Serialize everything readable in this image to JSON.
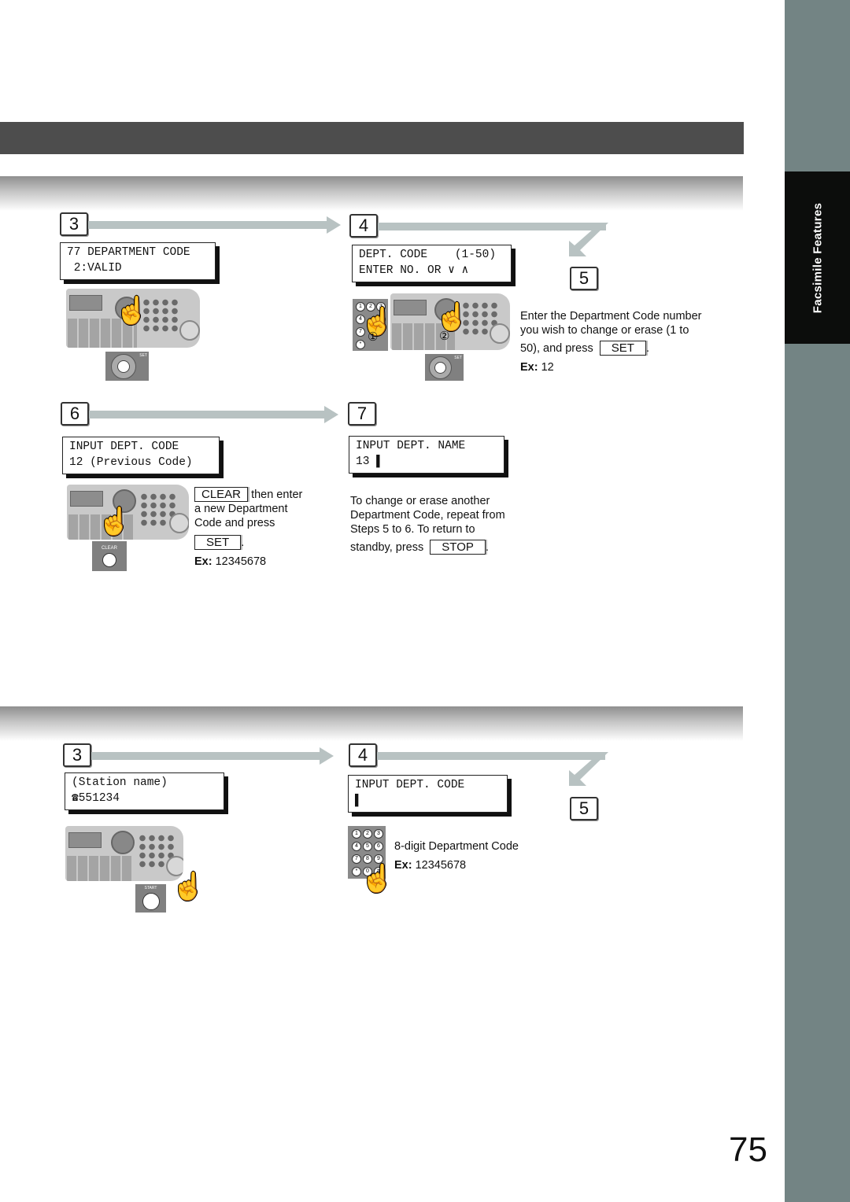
{
  "sidebar": {
    "tab_label": "Facsimile Features"
  },
  "page_number": "75",
  "section1": {
    "steps": [
      {
        "num": "3",
        "lcd": [
          "77 DEPARTMENT CODE",
          " 2:VALID"
        ],
        "key_label": "SET"
      },
      {
        "num": "4",
        "lcd": [
          "DEPT. CODE    (1-50)",
          "ENTER NO. OR ∨ ∧"
        ],
        "callouts": [
          "①",
          "②"
        ],
        "key_label": "SET"
      },
      {
        "num": "5",
        "text1": "Enter the Department Code number",
        "text2": "you wish to change or erase (1 to",
        "text3": "50), and press",
        "button": "SET",
        "period": ".",
        "ex_label": "Ex:",
        "ex_value": "12"
      },
      {
        "num": "6",
        "lcd": [
          "INPUT DEPT. CODE",
          "12 (Previous Code)"
        ],
        "button_clear": "CLEAR",
        "text_after_clear": "then enter",
        "text2": "a new Department",
        "text3": "Code and press",
        "button_set": "SET",
        "period": ".",
        "ex_label": "Ex:",
        "ex_value": "12345678",
        "key_label": "CLEAR"
      },
      {
        "num": "7",
        "lcd": [
          "INPUT DEPT. NAME",
          "13 ▌"
        ],
        "text1": "To change or erase another",
        "text2": "Department Code, repeat from",
        "text3": "Steps 5 to 6. To return to",
        "text4": "standby, press",
        "button": "STOP",
        "period": "."
      }
    ]
  },
  "section2": {
    "steps": [
      {
        "num": "3",
        "lcd": [
          "(Station name)",
          "☎551234"
        ],
        "key_label": "START"
      },
      {
        "num": "4",
        "lcd": [
          "INPUT DEPT. CODE",
          "▌"
        ],
        "text1": "8-digit Department Code",
        "ex_label": "Ex:",
        "ex_value": "12345678"
      },
      {
        "num": "5"
      }
    ]
  },
  "keypad_keys": [
    "1",
    "2",
    "3",
    "4",
    "5",
    "6",
    "7",
    "8",
    "9",
    "*",
    "0",
    "#"
  ]
}
